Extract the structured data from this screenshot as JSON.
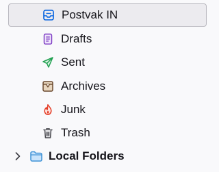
{
  "folders": [
    {
      "label": "Postvak IN",
      "icon": "inbox-icon",
      "selected": true
    },
    {
      "label": "Drafts",
      "icon": "drafts-icon",
      "selected": false
    },
    {
      "label": "Sent",
      "icon": "sent-icon",
      "selected": false
    },
    {
      "label": "Archives",
      "icon": "archive-icon",
      "selected": false
    },
    {
      "label": "Junk",
      "icon": "junk-icon",
      "selected": false
    },
    {
      "label": "Trash",
      "icon": "trash-icon",
      "selected": false
    }
  ],
  "local_folders": {
    "label": "Local Folders",
    "icon": "folder-icon",
    "expand_icon": "chevron-right-icon"
  },
  "colors": {
    "inbox": "#0061e0",
    "drafts": "#7f3fc4",
    "sent": "#20a050",
    "archive": "#6b4a2f",
    "junk": "#e33a24",
    "trash": "#4a4a50",
    "local_folder": "#3f92d6",
    "selected_bg": "#ecebef"
  }
}
